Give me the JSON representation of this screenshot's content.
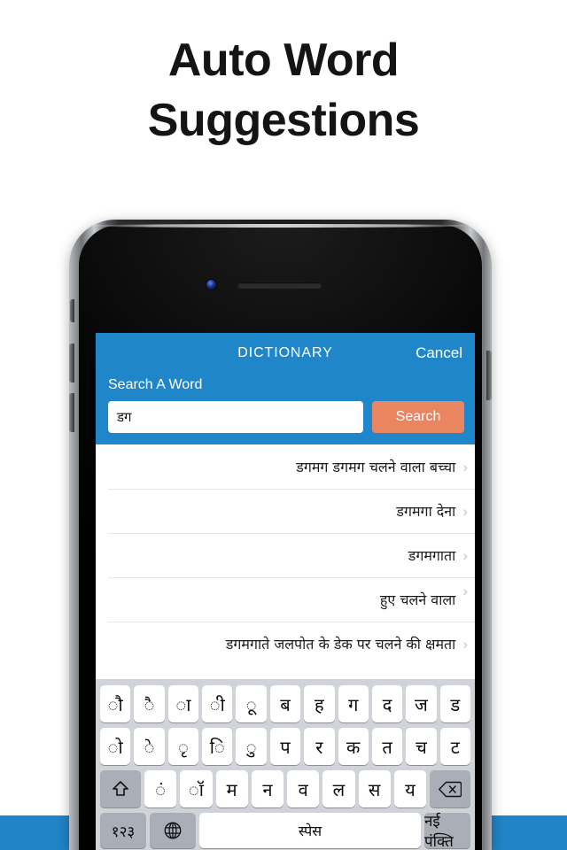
{
  "promo": {
    "line1": "Auto Word",
    "line2": "Suggestions"
  },
  "colors": {
    "header_blue": "#1f86c9",
    "band_blue": "#2084c6",
    "search_button": "#e98560",
    "keyboard_bg": "#d0d3d8",
    "key_bg": "#ffffff",
    "key_dark_bg": "#a9aeb7",
    "chevron": "#c7c7cc"
  },
  "app": {
    "nav": {
      "title": "DICTIONARY",
      "cancel_label": "Cancel"
    },
    "search": {
      "label": "Search A Word",
      "value": "डग",
      "placeholder": "Search A Word",
      "button_label": "Search"
    },
    "suggestions": [
      {
        "text": "डगमग डगमग चलने वाला बच्चा",
        "chevron": "›"
      },
      {
        "text": "डगमगा देना",
        "chevron": "›"
      },
      {
        "text": "डगमगाता",
        "chevron": "›"
      },
      {
        "text": "हुए चलने वाला",
        "chevron": "›"
      },
      {
        "text": "डगमगाते जलपोत के डेक पर चलने की क्षमता",
        "chevron": "›"
      }
    ]
  },
  "keyboard": {
    "language": "Hindi (Devanagari)",
    "row1": [
      "ौ",
      "ै",
      "ा",
      "ी",
      "ू",
      "ब",
      "ह",
      "ग",
      "द",
      "ज",
      "ड"
    ],
    "row2": [
      "ो",
      "े",
      "ृ",
      "ि",
      "ु",
      "प",
      "र",
      "क",
      "त",
      "च",
      "ट"
    ],
    "row3_keys": [
      "ं",
      "ॉ",
      "म",
      "न",
      "व",
      "ल",
      "स",
      "य"
    ],
    "shift_icon": "shift-arrow-icon",
    "backspace_icon": "backspace-icon",
    "numbers_label": "१२३",
    "globe_icon": "globe-icon",
    "space_label": "स्पेस",
    "return_label": "नई पंक्ति"
  },
  "phone": {
    "camera_icon": "front-camera-icon",
    "speaker_icon": "earpiece-speaker-icon"
  }
}
